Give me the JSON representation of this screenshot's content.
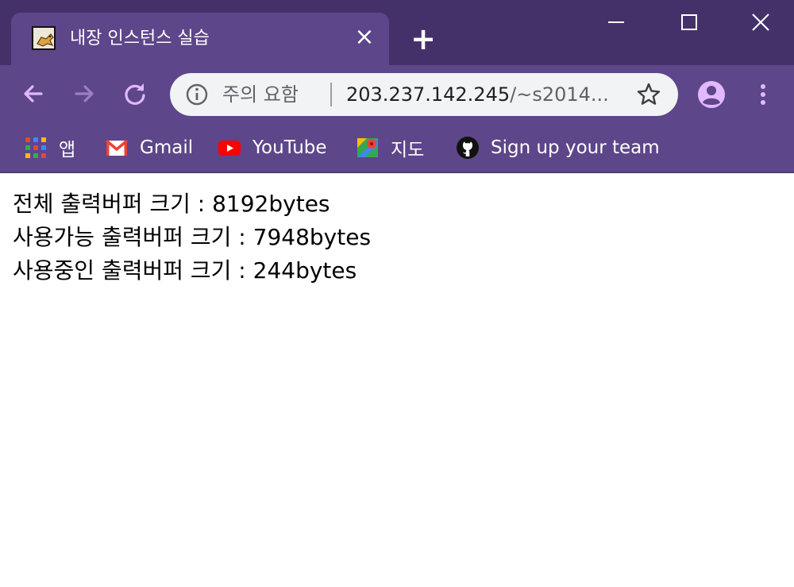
{
  "browser": {
    "tab": {
      "title": "내장 인스턴스 실습",
      "close_symbol": "×",
      "favicon": "tomcat-icon"
    },
    "new_tab_symbol": "+",
    "window_controls": [
      "minimize-icon",
      "maximize-icon",
      "close-icon"
    ],
    "accent_color": "#5d468a",
    "frame_color": "#45316a"
  },
  "toolbar": {
    "back_icon": "arrow-left-icon",
    "forward_icon": "arrow-right-icon",
    "reload_icon": "reload-icon",
    "omnibox": {
      "security_label": "주의 요함",
      "url_host": "203.237.142.245",
      "url_rest": "/~s2014..."
    },
    "star_icon": "star-icon",
    "profile_icon": "account-icon",
    "menu_icon": "more-vert-icon"
  },
  "bookmarks": [
    {
      "label": "앱",
      "icon": "apps-grid-icon"
    },
    {
      "label": "Gmail",
      "icon": "gmail-icon"
    },
    {
      "label": "YouTube",
      "icon": "youtube-icon"
    },
    {
      "label": "지도",
      "icon": "maps-icon"
    },
    {
      "label": "Sign up your team",
      "icon": "github-icon"
    }
  ],
  "page": {
    "lines": [
      "전체 출력버퍼 크기 : 8192bytes",
      "사용가능 출력버퍼 크기 : 7948bytes",
      "사용중인 출력버퍼 크기 : 244bytes"
    ]
  }
}
